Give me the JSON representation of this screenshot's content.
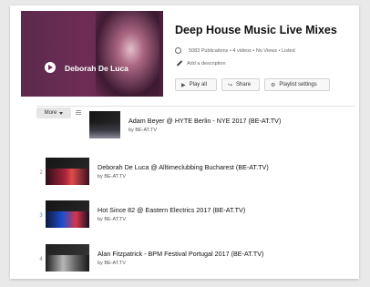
{
  "header": {
    "hero_name": "Deborah De Luca",
    "playlist_title": "Deep House Music Live Mixes",
    "meta": "5083 Publications • 4 videos • No Views • Listed",
    "add_description": "Add a description",
    "buttons": {
      "play_all": "Play all",
      "share": "Share",
      "playlist_settings": "Playlist settings"
    }
  },
  "list": {
    "more_label": "More",
    "items": [
      {
        "index": "",
        "title": "Adam Beyer @ HYTE Berlin - NYE 2017 (BE-AT.TV)",
        "by": "by BE-AT.TV"
      },
      {
        "index": "2",
        "title": "Deborah De Luca @ Alltimeclubbing Bucharest (BE-AT.TV)",
        "by": "by BE-AT.TV"
      },
      {
        "index": "3",
        "title": "Hot Since 82 @ Eastern Electrics 2017 (BE-AT.TV)",
        "by": "by BE-AT.TV"
      },
      {
        "index": "4",
        "title": "Alan Fitzpatrick - BPM Festival Portugal 2017 (BE-AT.TV)",
        "by": "by BE-AT.TV"
      }
    ]
  },
  "colors": {
    "hero": "#6e2d55",
    "background": "#e9e9e9"
  }
}
